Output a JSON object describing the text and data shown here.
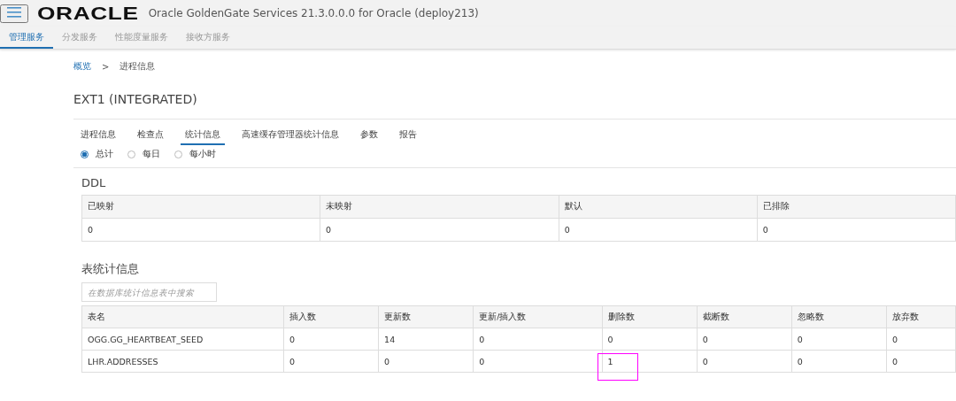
{
  "header": {
    "logo": "ORACLE",
    "title": "Oracle GoldenGate Services 21.3.0.0.0 for Oracle (deploy213)"
  },
  "nav": [
    {
      "label": "管理服务",
      "selected": true
    },
    {
      "label": "分发服务",
      "selected": false
    },
    {
      "label": "性能度量服务",
      "selected": false
    },
    {
      "label": "接收方服务",
      "selected": false
    }
  ],
  "breadcrumb": [
    {
      "label": "概览",
      "link": true
    },
    {
      "label": ">",
      "link": false
    },
    {
      "label": "进程信息",
      "link": false
    }
  ],
  "page_title": "EXT1 (INTEGRATED)",
  "tabs": [
    {
      "label": "进程信息",
      "selected": false
    },
    {
      "label": "检查点",
      "selected": false
    },
    {
      "label": "统计信息",
      "selected": true
    },
    {
      "label": "高速缓存管理器统计信息",
      "selected": false
    },
    {
      "label": "参数",
      "selected": false
    },
    {
      "label": "报告",
      "selected": false
    }
  ],
  "period": [
    {
      "label": "总计",
      "selected": true
    },
    {
      "label": "每日",
      "selected": false
    },
    {
      "label": "每小时",
      "selected": false
    }
  ],
  "ddl": {
    "title": "DDL",
    "columns": [
      "已映射",
      "未映射",
      "默认",
      "已排除"
    ],
    "values": [
      "0",
      "0",
      "0",
      "0"
    ]
  },
  "table_stats": {
    "title": "表统计信息",
    "search": {
      "placeholder": "在数据库统计信息表中搜索"
    },
    "columns": [
      "表名",
      "插入数",
      "更新数",
      "更新/插入数",
      "删除数",
      "截断数",
      "忽略数",
      "放弃数"
    ],
    "rows": [
      {
        "cells": [
          {
            "text": "OGG.GG_HEARTBEAT_SEED",
            "highlighted": false
          },
          {
            "text": "0",
            "highlighted": false
          },
          {
            "text": "14",
            "highlighted": false
          },
          {
            "text": "0",
            "highlighted": false
          },
          {
            "text": "0",
            "highlighted": false
          },
          {
            "text": "0",
            "highlighted": false
          },
          {
            "text": "0",
            "highlighted": false
          },
          {
            "text": "0",
            "highlighted": false
          }
        ]
      },
      {
        "cells": [
          {
            "text": "LHR.ADDRESSES",
            "highlighted": false
          },
          {
            "text": "0",
            "highlighted": false
          },
          {
            "text": "0",
            "highlighted": false
          },
          {
            "text": "0",
            "highlighted": false
          },
          {
            "text": "1",
            "highlighted": true
          },
          {
            "text": "0",
            "highlighted": false
          },
          {
            "text": "0",
            "highlighted": false
          },
          {
            "text": "0",
            "highlighted": false
          }
        ]
      }
    ]
  }
}
